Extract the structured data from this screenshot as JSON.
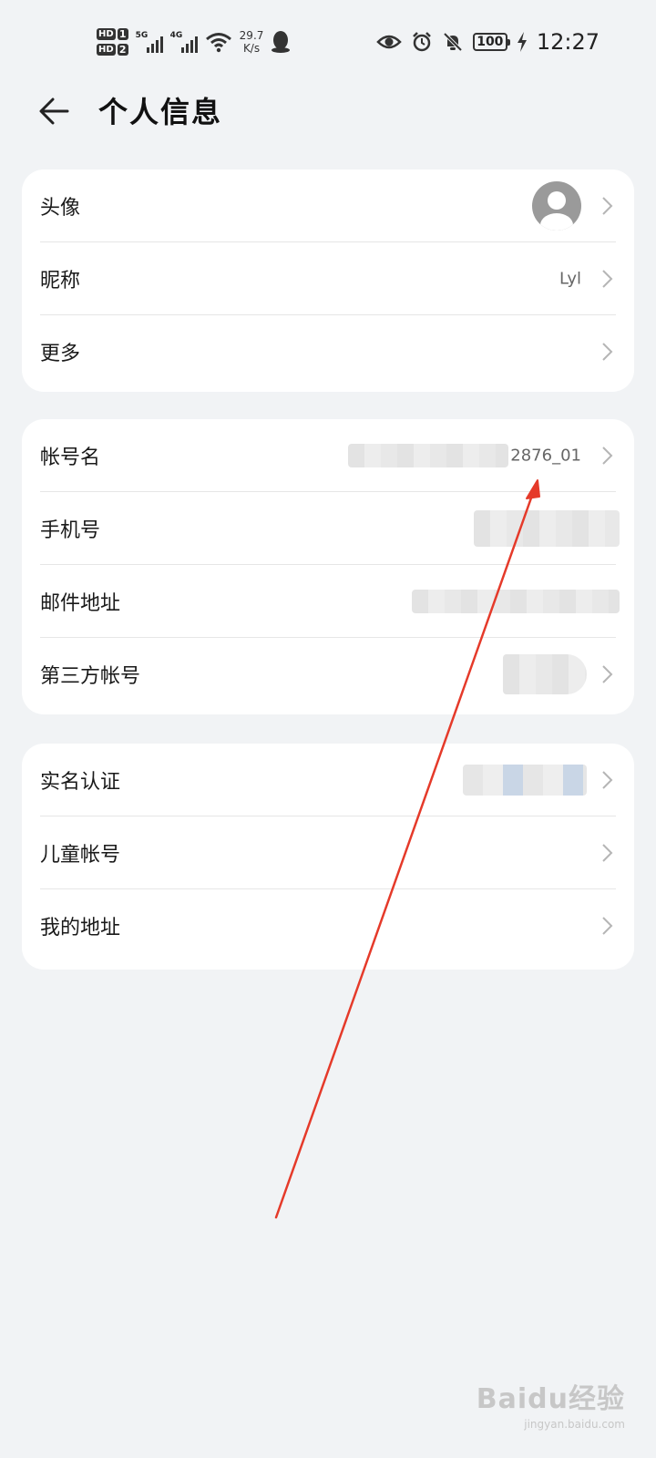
{
  "status_bar": {
    "sim1": "HD",
    "sim1_num": "1",
    "sim2": "HD",
    "sim2_num": "2",
    "net1": "5G",
    "net2": "4G",
    "speed_value": "29.7",
    "speed_unit": "K/s",
    "battery": "100",
    "time": "12:27"
  },
  "header": {
    "title": "个人信息"
  },
  "cards": {
    "profile": {
      "avatar_label": "头像",
      "nickname_label": "昵称",
      "nickname_value": "Lyl",
      "more_label": "更多"
    },
    "account": {
      "account_name_label": "帐号名",
      "account_name_value": "2876_01",
      "phone_label": "手机号",
      "email_label": "邮件地址",
      "third_party_label": "第三方帐号"
    },
    "misc": {
      "realname_label": "实名认证",
      "child_label": "儿童帐号",
      "address_label": "我的地址"
    }
  },
  "watermark": {
    "brand": "Baidu经验",
    "url": "jingyan.baidu.com"
  },
  "colors": {
    "background": "#f1f3f5",
    "card": "#ffffff",
    "annotation_arrow": "#e53a2a"
  }
}
